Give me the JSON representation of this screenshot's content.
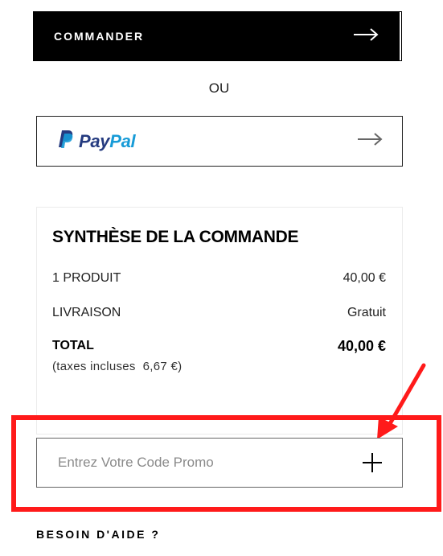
{
  "checkout": {
    "commander_label": "COMMANDER",
    "or_label": "OU",
    "paypal": {
      "word_pay": "Pay",
      "word_pal": "Pal",
      "brand_colors": {
        "pay": "#253b80",
        "pal": "#179bd7"
      }
    }
  },
  "summary": {
    "title": "SYNTHÈSE DE LA COMMANDE",
    "rows": [
      {
        "label": "1 PRODUIT",
        "value": "40,00 €"
      },
      {
        "label": "LIVRAISON",
        "value": "Gratuit"
      }
    ],
    "total_label": "TOTAL",
    "total_value": "40,00 €",
    "tax_note": "(taxes incluses  6,67 €)"
  },
  "promo": {
    "placeholder": "Entrez Votre Code Promo",
    "value": ""
  },
  "help": {
    "label": "BESOIN D'AIDE ?"
  },
  "icons": {
    "commander_arrow": "arrow-right-icon",
    "paypal_arrow": "arrow-right-icon",
    "promo_add": "plus-icon",
    "annotation": "red-pointer-arrow"
  },
  "colors": {
    "primary": "#000000",
    "highlight": "#ff1a1a"
  }
}
